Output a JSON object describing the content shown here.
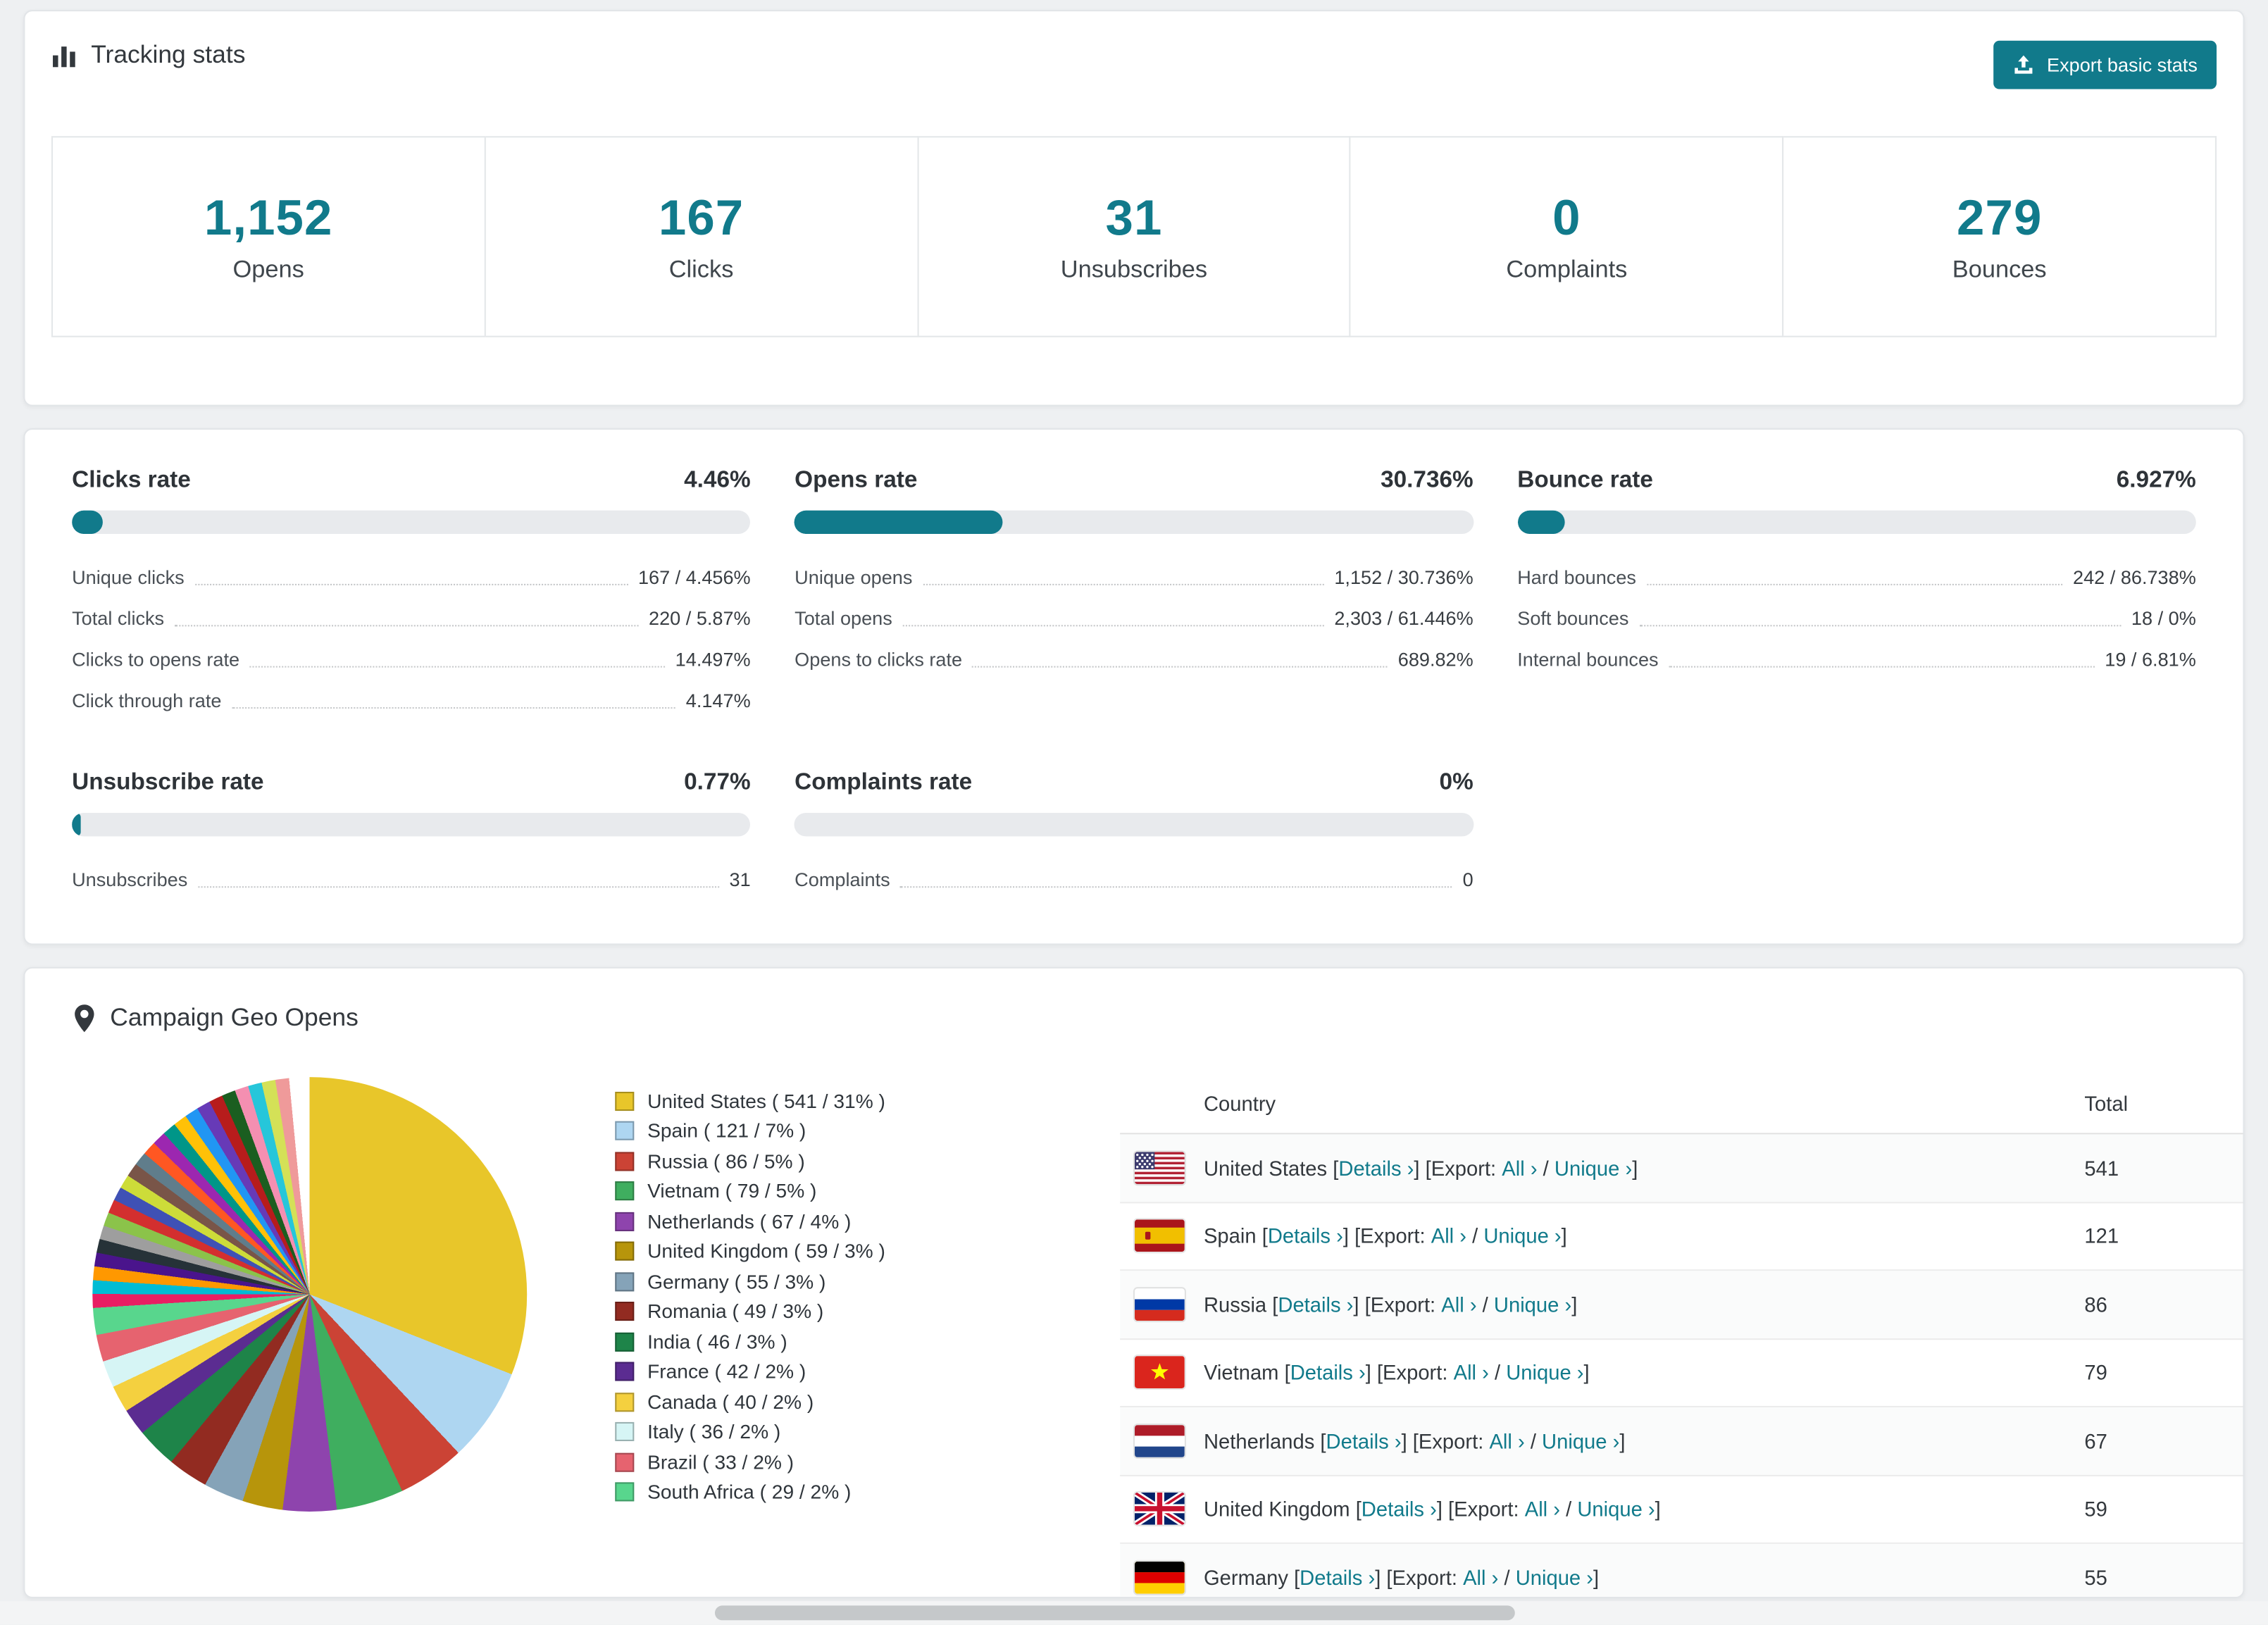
{
  "colors": {
    "accent": "#117a8b"
  },
  "header": {
    "title": "Tracking stats",
    "export_button": "Export basic stats"
  },
  "stats": [
    {
      "value": "1,152",
      "label": "Opens"
    },
    {
      "value": "167",
      "label": "Clicks"
    },
    {
      "value": "31",
      "label": "Unsubscribes"
    },
    {
      "value": "0",
      "label": "Complaints"
    },
    {
      "value": "279",
      "label": "Bounces"
    }
  ],
  "rates": [
    {
      "title": "Clicks rate",
      "value": "4.46%",
      "percent": 4.46,
      "rows": [
        {
          "label": "Unique clicks",
          "value": "167 / 4.456%"
        },
        {
          "label": "Total clicks",
          "value": "220 / 5.87%"
        },
        {
          "label": "Clicks to opens rate",
          "value": "14.497%"
        },
        {
          "label": "Click through rate",
          "value": "4.147%"
        }
      ]
    },
    {
      "title": "Opens rate",
      "value": "30.736%",
      "percent": 30.736,
      "rows": [
        {
          "label": "Unique opens",
          "value": "1,152 / 30.736%"
        },
        {
          "label": "Total opens",
          "value": "2,303 / 61.446%"
        },
        {
          "label": "Opens to clicks rate",
          "value": "689.82%"
        }
      ]
    },
    {
      "title": "Bounce rate",
      "value": "6.927%",
      "percent": 6.927,
      "rows": [
        {
          "label": "Hard bounces",
          "value": "242 / 86.738%"
        },
        {
          "label": "Soft bounces",
          "value": "18 / 0%"
        },
        {
          "label": "Internal bounces",
          "value": "19 / 6.81%"
        }
      ]
    },
    {
      "title": "Unsubscribe rate",
      "value": "0.77%",
      "percent": 0.77,
      "rows": [
        {
          "label": "Unsubscribes",
          "value": "31"
        }
      ]
    },
    {
      "title": "Complaints rate",
      "value": "0%",
      "percent": 0,
      "rows": [
        {
          "label": "Complaints",
          "value": "0"
        }
      ]
    }
  ],
  "geo": {
    "title": "Campaign Geo Opens",
    "table": {
      "headers": {
        "country": "Country",
        "total": "Total"
      },
      "links": {
        "details": "Details ›",
        "all": "All ›",
        "unique": "Unique ›"
      },
      "text": {
        "before_details": " [",
        "export_segment": "] [Export: ",
        "separator": " / ",
        "close": "]"
      },
      "rows": [
        {
          "country": "United States",
          "flag": "us",
          "total": "541"
        },
        {
          "country": "Spain",
          "flag": "es",
          "total": "121"
        },
        {
          "country": "Russia",
          "flag": "ru",
          "total": "86"
        },
        {
          "country": "Vietnam",
          "flag": "vn",
          "total": "79"
        },
        {
          "country": "Netherlands",
          "flag": "nl",
          "total": "67"
        },
        {
          "country": "United Kingdom",
          "flag": "gb",
          "total": "59"
        },
        {
          "country": "Germany",
          "flag": "de",
          "total": "55"
        }
      ]
    }
  },
  "chart_data": {
    "type": "pie",
    "title": "Campaign Geo Opens",
    "slices": [
      {
        "label": "United States",
        "count": 541,
        "percent": 31,
        "color": "#e8c62a",
        "legend": "United States ( 541 / 31% )"
      },
      {
        "label": "Spain",
        "count": 121,
        "percent": 7,
        "color": "#aed6f1",
        "legend": "Spain ( 121 / 7% )"
      },
      {
        "label": "Russia",
        "count": 86,
        "percent": 5,
        "color": "#cb4335",
        "legend": "Russia ( 86 / 5% )"
      },
      {
        "label": "Vietnam",
        "count": 79,
        "percent": 5,
        "color": "#3fae5f",
        "legend": "Vietnam ( 79 / 5% )"
      },
      {
        "label": "Netherlands",
        "count": 67,
        "percent": 4,
        "color": "#8e44ad",
        "legend": "Netherlands ( 67 / 4% )"
      },
      {
        "label": "United Kingdom",
        "count": 59,
        "percent": 3,
        "color": "#b7950b",
        "legend": "United Kingdom ( 59 / 3% )"
      },
      {
        "label": "Germany",
        "count": 55,
        "percent": 3,
        "color": "#85a3b8",
        "legend": "Germany ( 55 / 3% )"
      },
      {
        "label": "Romania",
        "count": 49,
        "percent": 3,
        "color": "#922b21",
        "legend": "Romania ( 49 / 3% )"
      },
      {
        "label": "India",
        "count": 46,
        "percent": 3,
        "color": "#1e8449",
        "legend": "India ( 46 / 3% )"
      },
      {
        "label": "France",
        "count": 42,
        "percent": 2,
        "color": "#5b2c91",
        "legend": "France ( 42 / 2% )"
      },
      {
        "label": "Canada",
        "count": 40,
        "percent": 2,
        "color": "#f4d03f",
        "legend": "Canada ( 40 / 2% )"
      },
      {
        "label": "Italy",
        "count": 36,
        "percent": 2,
        "color": "#d6f5f5",
        "legend": "Italy ( 36 / 2% )"
      },
      {
        "label": "Brazil",
        "count": 33,
        "percent": 2,
        "color": "#e6636f",
        "legend": "Brazil ( 33 / 2% )"
      },
      {
        "label": "South Africa",
        "count": 29,
        "percent": 2,
        "color": "#58d68d",
        "legend": "South Africa ( 29 / 2% )"
      }
    ],
    "other_slices": [
      {
        "percent": 1.02,
        "color": "#e91e63"
      },
      {
        "percent": 1.02,
        "color": "#00bcd4"
      },
      {
        "percent": 1.02,
        "color": "#ff9800"
      },
      {
        "percent": 1.02,
        "color": "#4a148c"
      },
      {
        "percent": 1.02,
        "color": "#263238"
      },
      {
        "percent": 1.02,
        "color": "#9e9e9e"
      },
      {
        "percent": 1.02,
        "color": "#8bc34a"
      },
      {
        "percent": 1.02,
        "color": "#d32f2f"
      },
      {
        "percent": 1.02,
        "color": "#3f51b5"
      },
      {
        "percent": 1.02,
        "color": "#cddc39"
      },
      {
        "percent": 1.02,
        "color": "#795548"
      },
      {
        "percent": 1.02,
        "color": "#607d8b"
      },
      {
        "percent": 1.02,
        "color": "#ff5722"
      },
      {
        "percent": 1.02,
        "color": "#9c27b0"
      },
      {
        "percent": 1.02,
        "color": "#009688"
      },
      {
        "percent": 1.02,
        "color": "#ffc107"
      },
      {
        "percent": 1.02,
        "color": "#2196f3"
      },
      {
        "percent": 1.02,
        "color": "#673ab7"
      },
      {
        "percent": 1.02,
        "color": "#b71c1c"
      },
      {
        "percent": 1.02,
        "color": "#1b5e20"
      },
      {
        "percent": 1.02,
        "color": "#f48fb1"
      },
      {
        "percent": 1.02,
        "color": "#26c6da"
      },
      {
        "percent": 1.02,
        "color": "#d4e157"
      },
      {
        "percent": 1.02,
        "color": "#ef9a9a"
      },
      {
        "percent": 1.52,
        "color": "#ffffff"
      }
    ]
  }
}
